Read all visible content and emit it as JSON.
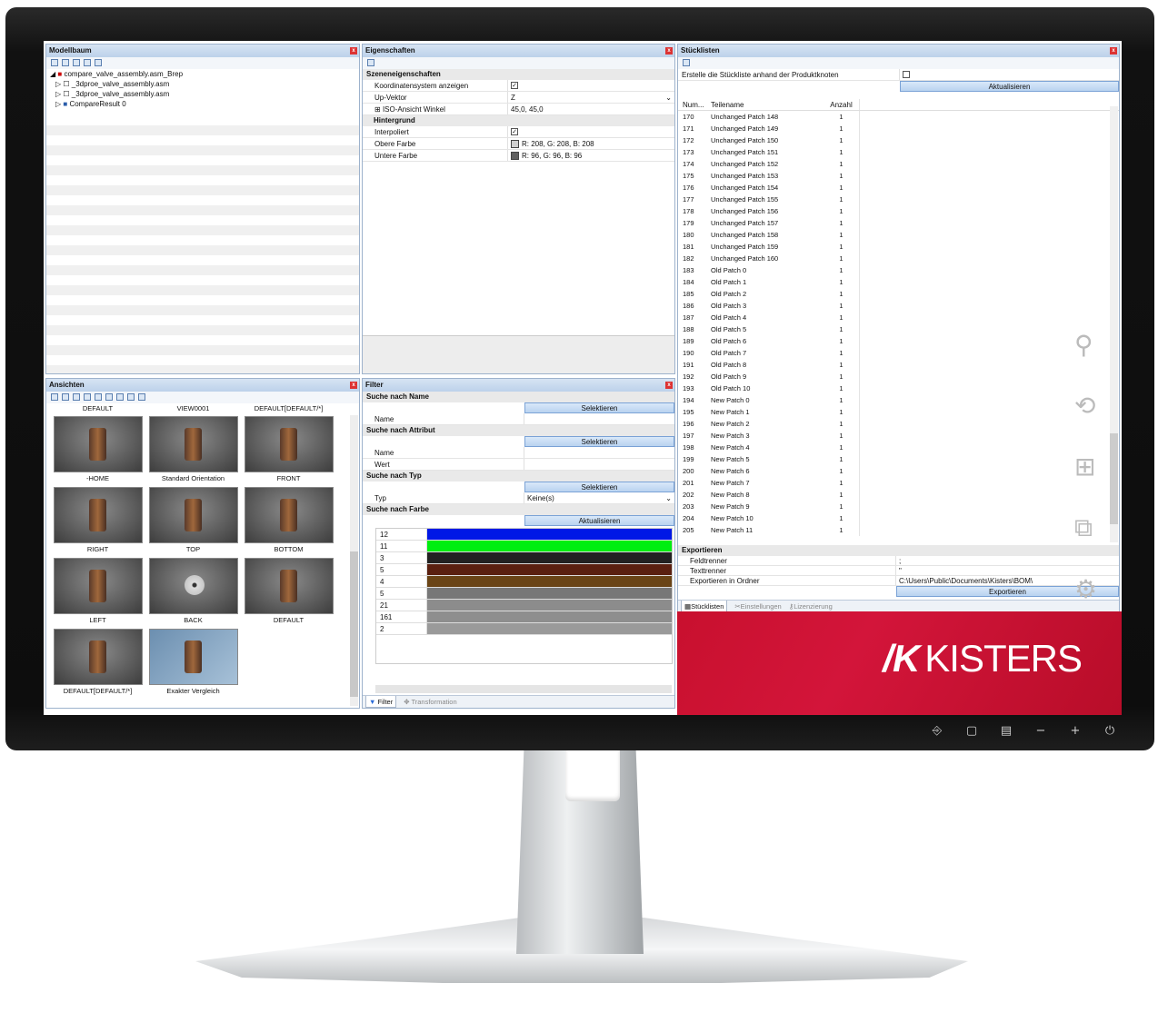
{
  "modelltree": {
    "title": "Modellbaum",
    "items": [
      "compare_valve_assembly.asm_Brep",
      "_3dproe_valve_assembly.asm",
      "_3dproe_valve_assembly.asm",
      "CompareResult 0"
    ]
  },
  "props": {
    "title": "Eigenschaften",
    "cat1": "Szeneneigenschaften",
    "k1": "Koordinatensystem anzeigen",
    "k2": "Up-Vektor",
    "v2": "Z",
    "k3": "ISO-Ansicht Winkel",
    "v3": "45,0, 45,0",
    "cat2": "Hintergrund",
    "k4": "Interpoliert",
    "k5": "Obere Farbe",
    "v5": "R: 208, G: 208, B: 208",
    "k6": "Untere Farbe",
    "v6": "R: 96, G: 96, B: 96"
  },
  "views": {
    "title": "Ansichten",
    "top": [
      "DEFAULT",
      "VIEW0001",
      "DEFAULT[DEFAULT/*]"
    ],
    "cells": [
      "-HOME",
      "Standard Orientation",
      "FRONT",
      "RIGHT",
      "TOP",
      "BOTTOM",
      "LEFT",
      "BACK",
      "DEFAULT",
      "DEFAULT[DEFAULT/*]",
      "Exakter Vergleich"
    ]
  },
  "filter": {
    "title": "Filter",
    "s1": "Suche nach Name",
    "sel": "Selektieren",
    "name": "Name",
    "s2": "Suche nach Attribut",
    "wert": "Wert",
    "s3": "Suche nach Typ",
    "typ": "Typ",
    "typval": "Keine(s)",
    "s4": "Suche nach Farbe",
    "akt": "Aktualisieren",
    "colors": [
      {
        "n": "12",
        "c": "#0018e6"
      },
      {
        "n": "11",
        "c": "#00ee10"
      },
      {
        "n": "3",
        "c": "#222222"
      },
      {
        "n": "5",
        "c": "#5a2010"
      },
      {
        "n": "4",
        "c": "#6a4416"
      },
      {
        "n": "5",
        "c": "#777777"
      },
      {
        "n": "21",
        "c": "#8c8c8c"
      },
      {
        "n": "161",
        "c": "#8e8e8e"
      },
      {
        "n": "2",
        "c": "#9a9a9a"
      }
    ],
    "tab1": "Filter",
    "tab2": "Transformation"
  },
  "bom": {
    "title": "Stücklisten",
    "create": "Erstelle die Stückliste anhand der Produktknoten",
    "akt": "Aktualisieren",
    "h1": "Num...",
    "h2": "Teilename",
    "h3": "Anzahl",
    "rows": [
      [
        "170",
        "Unchanged Patch 148",
        "1"
      ],
      [
        "171",
        "Unchanged Patch 149",
        "1"
      ],
      [
        "172",
        "Unchanged Patch 150",
        "1"
      ],
      [
        "173",
        "Unchanged Patch 151",
        "1"
      ],
      [
        "174",
        "Unchanged Patch 152",
        "1"
      ],
      [
        "175",
        "Unchanged Patch 153",
        "1"
      ],
      [
        "176",
        "Unchanged Patch 154",
        "1"
      ],
      [
        "177",
        "Unchanged Patch 155",
        "1"
      ],
      [
        "178",
        "Unchanged Patch 156",
        "1"
      ],
      [
        "179",
        "Unchanged Patch 157",
        "1"
      ],
      [
        "180",
        "Unchanged Patch 158",
        "1"
      ],
      [
        "181",
        "Unchanged Patch 159",
        "1"
      ],
      [
        "182",
        "Unchanged Patch 160",
        "1"
      ],
      [
        "183",
        "Old Patch 0",
        "1"
      ],
      [
        "184",
        "Old Patch 1",
        "1"
      ],
      [
        "185",
        "Old Patch 2",
        "1"
      ],
      [
        "186",
        "Old Patch 3",
        "1"
      ],
      [
        "187",
        "Old Patch 4",
        "1"
      ],
      [
        "188",
        "Old Patch 5",
        "1"
      ],
      [
        "189",
        "Old Patch 6",
        "1"
      ],
      [
        "190",
        "Old Patch 7",
        "1"
      ],
      [
        "191",
        "Old Patch 8",
        "1"
      ],
      [
        "192",
        "Old Patch 9",
        "1"
      ],
      [
        "193",
        "Old Patch 10",
        "1"
      ],
      [
        "194",
        "New Patch 0",
        "1"
      ],
      [
        "195",
        "New Patch 1",
        "1"
      ],
      [
        "196",
        "New Patch 2",
        "1"
      ],
      [
        "197",
        "New Patch 3",
        "1"
      ],
      [
        "198",
        "New Patch 4",
        "1"
      ],
      [
        "199",
        "New Patch 5",
        "1"
      ],
      [
        "200",
        "New Patch 6",
        "1"
      ],
      [
        "201",
        "New Patch 7",
        "1"
      ],
      [
        "202",
        "New Patch 8",
        "1"
      ],
      [
        "203",
        "New Patch 9",
        "1"
      ],
      [
        "204",
        "New Patch 10",
        "1"
      ],
      [
        "205",
        "New Patch 11",
        "1"
      ]
    ],
    "exp": "Exportieren",
    "feld": "Feldtrenner",
    "feldv": ";",
    "text": "Texttrenner",
    "textv": "\"",
    "ordner": "Exportieren in Ordner",
    "ordnerv": "C:\\Users\\Public\\Documents\\Kisters\\BOM\\",
    "expbtn": "Exportieren",
    "tab1": "Stücklisten",
    "tab2": "Einstellungen",
    "tab3": "Lizenzierung"
  },
  "brand": {
    "logo": "KISTERS"
  }
}
